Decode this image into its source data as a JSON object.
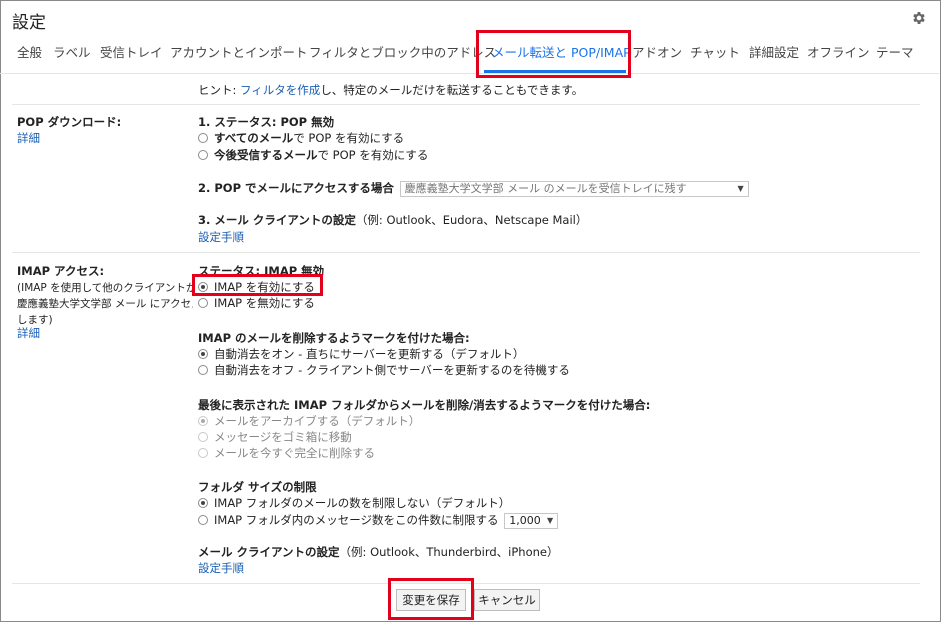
{
  "header": {
    "title": "設定"
  },
  "tabs": [
    {
      "label": "全般"
    },
    {
      "label": "ラベル"
    },
    {
      "label": "受信トレイ"
    },
    {
      "label": "アカウントとインポート"
    },
    {
      "label": "フィルタとブロック中のアドレス"
    },
    {
      "label": "メール転送と POP/IMAP"
    },
    {
      "label": "アドオン"
    },
    {
      "label": "チャット"
    },
    {
      "label": "詳細設定"
    },
    {
      "label": "オフライン"
    },
    {
      "label": "テーマ"
    }
  ],
  "hint": {
    "prefix": "ヒント: ",
    "link": "フィルタを作成",
    "suffix": "し、特定のメールだけを転送することもできます。"
  },
  "pop": {
    "label": "POP ダウンロード:",
    "details_link": "詳細",
    "status_heading": "1. ステータス: POP 無効",
    "opt_all_bold": "すべてのメール",
    "opt_all_rest": "で POP を有効にする",
    "opt_future_bold": "今後受信するメール",
    "opt_future_rest": "で POP を有効にする",
    "access_heading": "2. POP でメールにアクセスする場合",
    "access_select": "慶應義塾大学文学部 メール のメールを受信トレイに残す",
    "client_heading": "3. メール クライアントの設定",
    "client_examples": "（例: Outlook、Eudora、Netscape Mail）",
    "setup_link": "設定手順"
  },
  "imap": {
    "label": "IMAP アクセス:",
    "desc_line1": "(IMAP を使用して他のクライアントから",
    "desc_line2": "慶應義塾大学文学部 メール にアクセス",
    "desc_line3": "します)",
    "details_link": "詳細",
    "status_heading": "ステータス: IMAP 無効",
    "opt_enable": "IMAP を有効にする",
    "opt_disable": "IMAP を無効にする",
    "delete_heading": "IMAP のメールを削除するようマークを付けた場合:",
    "del_opt1": "自動消去をオン - 直ちにサーバーを更新する（デフォルト）",
    "del_opt2": "自動消去をオフ - クライアント側でサーバーを更新するのを待機する",
    "expunge_heading": "最後に表示された IMAP フォルダからメールを削除/消去するようマークを付けた場合:",
    "exp_opt1": "メールをアーカイブする（デフォルト）",
    "exp_opt2": "メッセージをゴミ箱に移動",
    "exp_opt3": "メールを今すぐ完全に削除する",
    "folder_heading": "フォルダ サイズの制限",
    "folder_opt1": "IMAP フォルダのメールの数を制限しない（デフォルト）",
    "folder_opt2": "IMAP フォルダ内のメッセージ数をこの件数に制限する",
    "folder_limit": "1,000",
    "client_heading": "メール クライアントの設定",
    "client_examples": "（例: Outlook、Thunderbird、iPhone）",
    "setup_link": "設定手順"
  },
  "footer": {
    "save_label": "変更を保存",
    "cancel_label": "キャンセル"
  },
  "colors": {
    "accent": "#1a73e8",
    "highlight": "#e3001b",
    "link": "#1a5fb4"
  }
}
